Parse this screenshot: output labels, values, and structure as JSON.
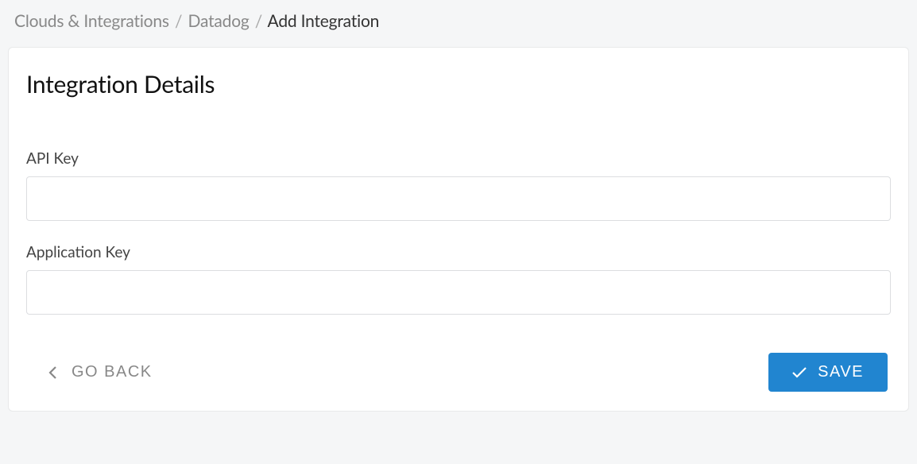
{
  "breadcrumb": {
    "item1": "Clouds & Integrations",
    "item2": "Datadog",
    "current": "Add Integration",
    "separator": "/"
  },
  "card": {
    "title": "Integration Details"
  },
  "form": {
    "api_key": {
      "label": "API Key",
      "value": ""
    },
    "application_key": {
      "label": "Application Key",
      "value": ""
    }
  },
  "actions": {
    "back_label": "GO BACK",
    "save_label": "SAVE"
  }
}
